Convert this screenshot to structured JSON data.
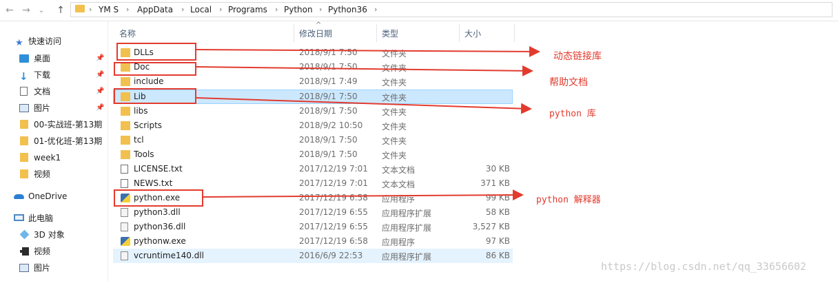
{
  "address_bar": {
    "crumbs": [
      "YM S",
      "AppData",
      "Local",
      "Programs",
      "Python",
      "Python36"
    ]
  },
  "nav_buttons": {
    "back": "←",
    "forward": "→",
    "recent": "⌄",
    "up": "↑"
  },
  "sidebar": {
    "quick_access": "快速访问",
    "pinned": [
      {
        "label": "桌面",
        "icon": "desktop-icon"
      },
      {
        "label": "下载",
        "icon": "download-icon"
      },
      {
        "label": "文档",
        "icon": "document-icon"
      },
      {
        "label": "图片",
        "icon": "pictures-icon"
      }
    ],
    "folders": [
      "00-实战班-第13期",
      "01-优化班-第13期",
      "week1",
      "视频"
    ],
    "onedrive": "OneDrive",
    "this_pc": "此电脑",
    "pc_items": [
      {
        "label": "3D 对象",
        "icon": "3d-objects-icon"
      },
      {
        "label": "视频",
        "icon": "video-icon"
      },
      {
        "label": "图片",
        "icon": "pictures-icon"
      }
    ]
  },
  "columns": {
    "name": "名称",
    "date": "修改日期",
    "type": "类型",
    "size": "大小"
  },
  "files": [
    {
      "name": "DLLs",
      "date": "2018/9/1 7:50",
      "type": "文件夹",
      "size": "",
      "icon": "folder-icon"
    },
    {
      "name": "Doc",
      "date": "2018/9/1 7:50",
      "type": "文件夹",
      "size": "",
      "icon": "folder-icon"
    },
    {
      "name": "include",
      "date": "2018/9/1 7:49",
      "type": "文件夹",
      "size": "",
      "icon": "folder-icon"
    },
    {
      "name": "Lib",
      "date": "2018/9/1 7:50",
      "type": "文件夹",
      "size": "",
      "icon": "folder-icon"
    },
    {
      "name": "libs",
      "date": "2018/9/1 7:50",
      "type": "文件夹",
      "size": "",
      "icon": "folder-icon"
    },
    {
      "name": "Scripts",
      "date": "2018/9/2 10:50",
      "type": "文件夹",
      "size": "",
      "icon": "folder-icon"
    },
    {
      "name": "tcl",
      "date": "2018/9/1 7:50",
      "type": "文件夹",
      "size": "",
      "icon": "folder-icon"
    },
    {
      "name": "Tools",
      "date": "2018/9/1 7:50",
      "type": "文件夹",
      "size": "",
      "icon": "folder-icon"
    },
    {
      "name": "LICENSE.txt",
      "date": "2017/12/19 7:01",
      "type": "文本文档",
      "size": "30 KB",
      "icon": "text-file-icon"
    },
    {
      "name": "NEWS.txt",
      "date": "2017/12/19 7:01",
      "type": "文本文档",
      "size": "371 KB",
      "icon": "text-file-icon"
    },
    {
      "name": "python.exe",
      "date": "2017/12/19 6:58",
      "type": "应用程序",
      "size": "99 KB",
      "icon": "python-exe-icon"
    },
    {
      "name": "python3.dll",
      "date": "2017/12/19 6:55",
      "type": "应用程序扩展",
      "size": "58 KB",
      "icon": "dll-icon"
    },
    {
      "name": "python36.dll",
      "date": "2017/12/19 6:55",
      "type": "应用程序扩展",
      "size": "3,527 KB",
      "icon": "dll-icon"
    },
    {
      "name": "pythonw.exe",
      "date": "2017/12/19 6:58",
      "type": "应用程序",
      "size": "97 KB",
      "icon": "python-exe-icon"
    },
    {
      "name": "vcruntime140.dll",
      "date": "2016/6/9 22:53",
      "type": "应用程序扩展",
      "size": "86 KB",
      "icon": "dll-icon"
    }
  ],
  "annotations": {
    "dlls": "动态链接库",
    "doc": "帮助文档",
    "lib": "python 库",
    "exe": "python 解释器"
  },
  "watermark": "https://blog.csdn.net/qq_33656602",
  "colors": {
    "annotation_red": "#e23b2e",
    "folder_yellow": "#f2c04e",
    "selection_blue": "#cce8ff"
  }
}
